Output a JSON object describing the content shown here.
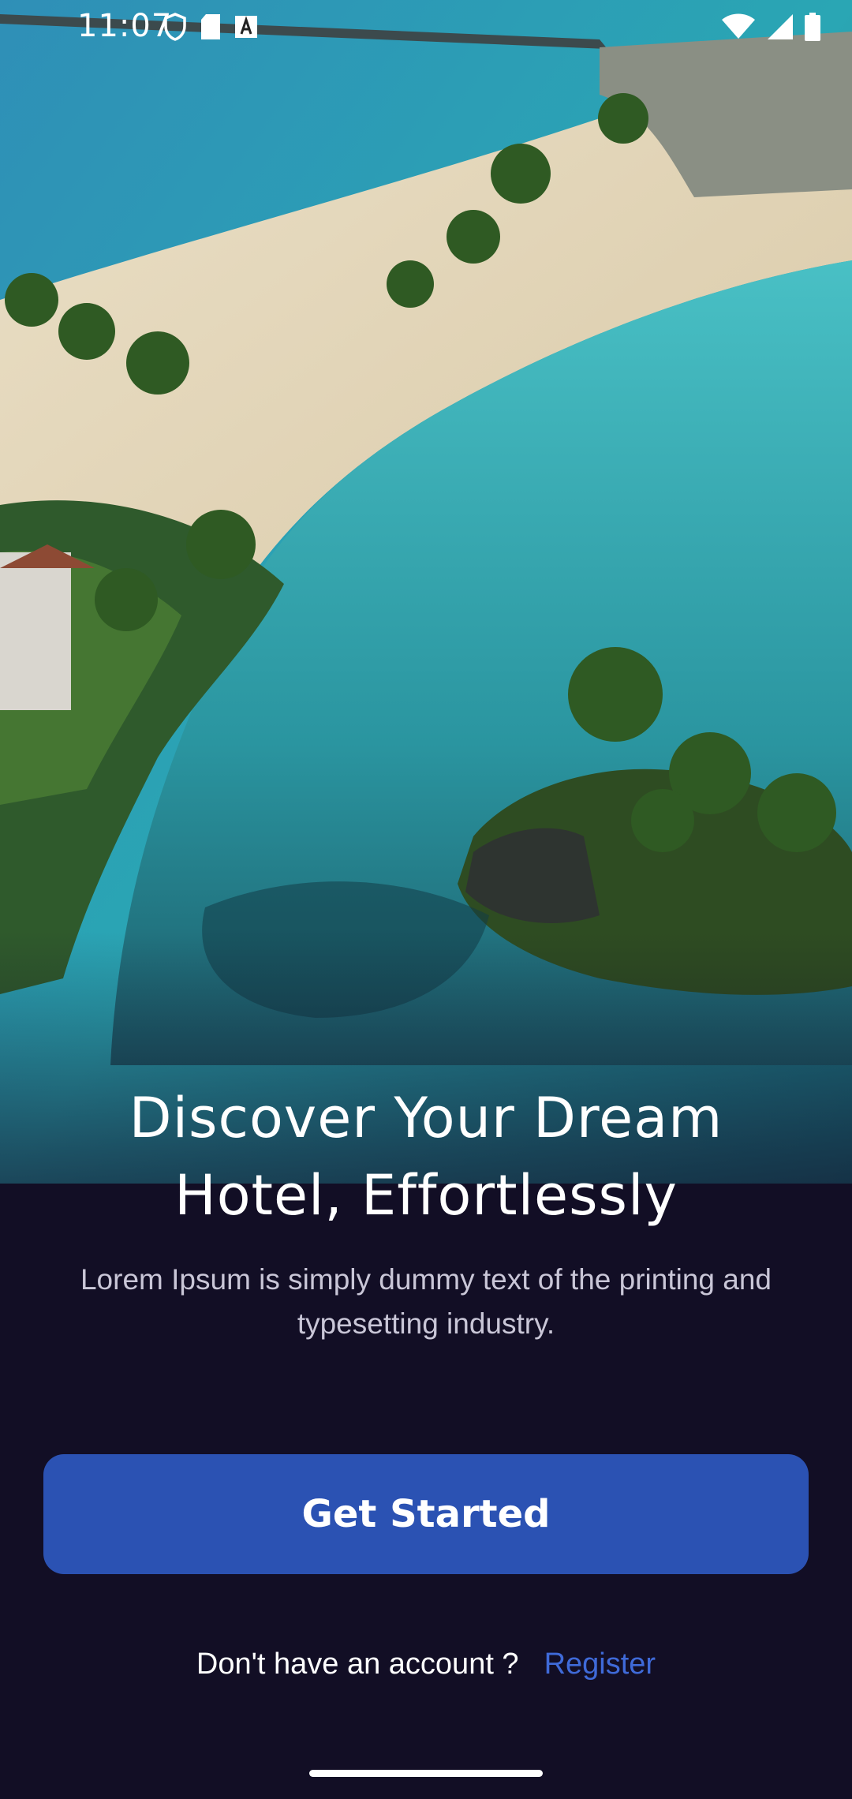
{
  "status_bar": {
    "time": "11:07",
    "left_icons": [
      "shield-icon",
      "sd-card-icon",
      "a-notification-icon"
    ],
    "right_icons": [
      "wifi-icon",
      "signal-icon",
      "battery-icon"
    ]
  },
  "hero": {
    "image": "tropical-resort-beach-aerial",
    "title_line1": "Discover Your Dream",
    "title_line2": "Hotel, Effortlessly",
    "subtitle_line1": "Lorem Ipsum is simply dummy text of the printing and",
    "subtitle_line2": "typesetting industry."
  },
  "actions": {
    "get_started_label": "Get Started",
    "account_prompt": "Don't have an account ?",
    "register_label": "Register"
  },
  "colors": {
    "background": "#120e25",
    "primary_button": "#2b52b3",
    "link": "#3f6ad8"
  }
}
